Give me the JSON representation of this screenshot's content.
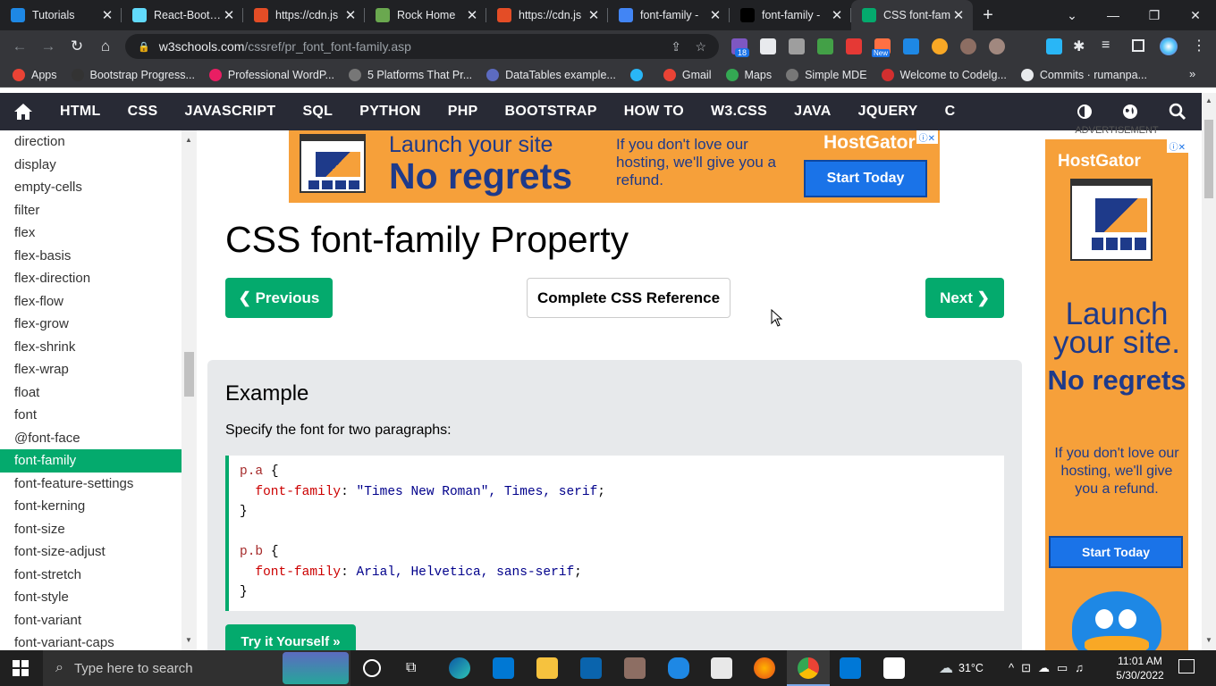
{
  "browser": {
    "tabs": [
      {
        "title": "Tutorials",
        "color": "#1e88e5"
      },
      {
        "title": "React-Bootstr",
        "color": "#61dafb"
      },
      {
        "title": "https://cdn.js",
        "color": "#e44d26"
      },
      {
        "title": "Rock Home",
        "color": "#6aa84f"
      },
      {
        "title": "https://cdn.js",
        "color": "#e44d26"
      },
      {
        "title": "font-family -",
        "color": "#4285f4"
      },
      {
        "title": "font-family -",
        "color": "#000000"
      },
      {
        "title": "CSS font-fam",
        "color": "#04aa6d"
      }
    ],
    "url_domain": "w3schools.com",
    "url_path": "/cssref/pr_font_font-family.asp",
    "extension_badge": "18",
    "extension_new": "New",
    "bookmarks": [
      {
        "label": "Apps",
        "color": "#ea4335"
      },
      {
        "label": "Bootstrap Progress...",
        "color": "#333333"
      },
      {
        "label": "Professional WordP...",
        "color": "#e91e63"
      },
      {
        "label": "5 Platforms That Pr...",
        "color": "#777777"
      },
      {
        "label": "DataTables example...",
        "color": "#5c6bc0"
      },
      {
        "label": "",
        "color": "#29b6f6"
      },
      {
        "label": "Gmail",
        "color": "#ea4335"
      },
      {
        "label": "Maps",
        "color": "#34a853"
      },
      {
        "label": "Simple MDE",
        "color": "#777777"
      },
      {
        "label": "Welcome to Codelg...",
        "color": "#d32f2f"
      },
      {
        "label": "Commits · rumanpa...",
        "color": "#e8eaed"
      }
    ]
  },
  "nav": {
    "items": [
      "HTML",
      "CSS",
      "JAVASCRIPT",
      "SQL",
      "PYTHON",
      "PHP",
      "BOOTSTRAP",
      "HOW TO",
      "W3.CSS",
      "JAVA",
      "JQUERY",
      "C"
    ]
  },
  "sidebar": {
    "items": [
      "direction",
      "display",
      "empty-cells",
      "filter",
      "flex",
      "flex-basis",
      "flex-direction",
      "flex-flow",
      "flex-grow",
      "flex-shrink",
      "flex-wrap",
      "float",
      "font",
      "@font-face",
      "font-family",
      "font-feature-settings",
      "font-kerning",
      "font-size",
      "font-size-adjust",
      "font-stretch",
      "font-style",
      "font-variant",
      "font-variant-caps"
    ],
    "active_index": 14
  },
  "ad_top": {
    "line1": "Launch your site",
    "line2": "No regrets",
    "copy": "If you don't love our hosting, we'll give you a refund.",
    "brand": "HostGator",
    "cta": "Start Today"
  },
  "ad_side": {
    "label": "ADVERTISEMENT",
    "brand": "HostGator",
    "headline": "Launch your site.",
    "bold": "No regrets",
    "copy": "If you don't love our hosting, we'll give you a refund.",
    "cta": "Start Today"
  },
  "main": {
    "title": "CSS font-family Property",
    "prev_label": "Previous",
    "ref_label": "Complete CSS Reference",
    "next_label": "Next",
    "example_heading": "Example",
    "example_desc": "Specify the font for two paragraphs:",
    "code": {
      "sel_a": "p.a",
      "sel_b": "p.b",
      "prop": "font-family",
      "val_a": "\"Times New Roman\", Times, serif",
      "val_b": "Arial, Helvetica, sans-serif"
    },
    "try_label": "Try it Yourself »"
  },
  "taskbar": {
    "search_placeholder": "Type here to search",
    "weather": "31°C",
    "time": "11:01 AM",
    "date": "5/30/2022"
  }
}
